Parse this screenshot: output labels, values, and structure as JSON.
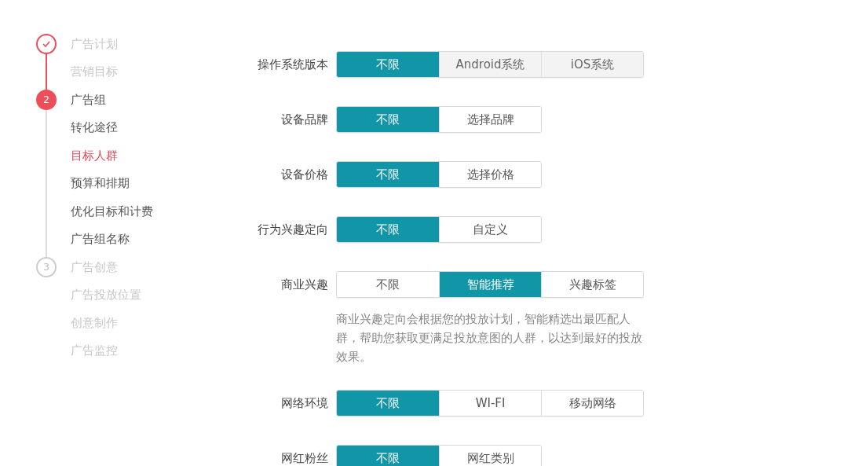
{
  "sidebar": {
    "steps": [
      {
        "kind": "done",
        "label": "广告计划",
        "children": [
          {
            "label": "营销目标",
            "selected": false
          }
        ]
      },
      {
        "kind": "current",
        "marker": "2",
        "label": "广告组",
        "children": [
          {
            "label": "转化途径",
            "selected": false
          },
          {
            "label": "目标人群",
            "selected": true
          },
          {
            "label": "预算和排期",
            "selected": false
          },
          {
            "label": "优化目标和计费",
            "selected": false
          },
          {
            "label": "广告组名称",
            "selected": false
          }
        ]
      },
      {
        "kind": "pending",
        "marker": "3",
        "label": "广告创意",
        "children": [
          {
            "label": "广告投放位置",
            "selected": false
          },
          {
            "label": "创意制作",
            "selected": false
          },
          {
            "label": "广告监控",
            "selected": false
          }
        ]
      }
    ]
  },
  "form": {
    "rows": [
      {
        "label": "操作系统版本",
        "options": [
          {
            "label": "不限",
            "selected": true,
            "disabled": false
          },
          {
            "label": "Android系统",
            "selected": false,
            "disabled": true
          },
          {
            "label": "iOS系统",
            "selected": false,
            "disabled": true
          }
        ]
      },
      {
        "label": "设备品牌",
        "options": [
          {
            "label": "不限",
            "selected": true,
            "disabled": false
          },
          {
            "label": "选择品牌",
            "selected": false,
            "disabled": false
          }
        ]
      },
      {
        "label": "设备价格",
        "options": [
          {
            "label": "不限",
            "selected": true,
            "disabled": false
          },
          {
            "label": "选择价格",
            "selected": false,
            "disabled": false
          }
        ]
      },
      {
        "label": "行为兴趣定向",
        "options": [
          {
            "label": "不限",
            "selected": true,
            "disabled": false
          },
          {
            "label": "自定义",
            "selected": false,
            "disabled": false
          }
        ]
      },
      {
        "label": "商业兴趣",
        "options": [
          {
            "label": "不限",
            "selected": false,
            "disabled": false
          },
          {
            "label": "智能推荐",
            "selected": true,
            "disabled": false
          },
          {
            "label": "兴趣标签",
            "selected": false,
            "disabled": false
          }
        ],
        "help": "商业兴趣定向会根据您的投放计划，智能精选出最匹配人群，帮助您获取更满足投放意图的人群，以达到最好的投放效果。"
      },
      {
        "label": "网络环境",
        "options": [
          {
            "label": "不限",
            "selected": true,
            "disabled": false
          },
          {
            "label": "WI-FI",
            "selected": false,
            "disabled": false
          },
          {
            "label": "移动网络",
            "selected": false,
            "disabled": false
          }
        ]
      },
      {
        "label": "网红粉丝",
        "options": [
          {
            "label": "不限",
            "selected": true,
            "disabled": false
          },
          {
            "label": "网红类别",
            "selected": false,
            "disabled": false
          }
        ]
      }
    ]
  }
}
